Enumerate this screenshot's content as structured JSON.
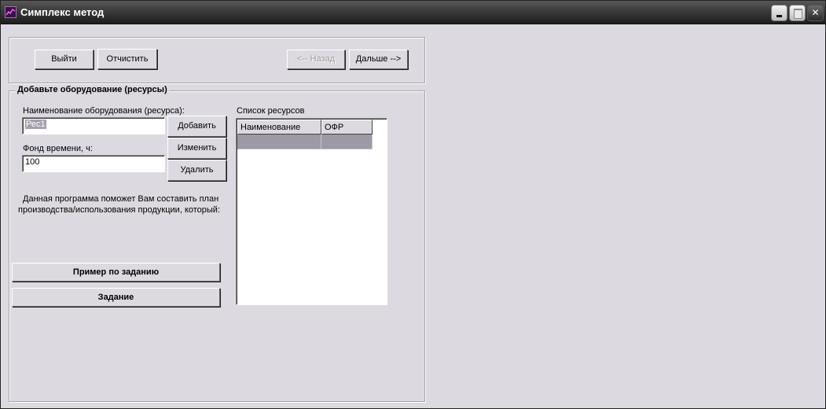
{
  "window": {
    "title": "Симплекс метод"
  },
  "toolbar": {
    "exit_label": "Выйти",
    "clear_label": "Отчистить",
    "back_label": "<-- Назад",
    "next_label": "Дальше -->"
  },
  "resources_group": {
    "legend": "Добавьте оборудование (ресурсы)",
    "name_label": "Наименование оборудования (ресурса):",
    "name_value": "Рес1",
    "time_label": "Фонд времени, ч:",
    "time_value": "100",
    "add_label": "Добавить",
    "edit_label": "Изменить",
    "delete_label": "Удалить",
    "description_line1": "Данная программа поможет Вам составить план",
    "description_line2": "производства/использования продукции, который:",
    "example_label": "Пример по заданию",
    "task_label": "Задание"
  },
  "resource_list": {
    "title": "Список ресурсов",
    "columns": [
      "Наименование",
      "ОФР"
    ],
    "rows": [
      [
        "",
        ""
      ]
    ]
  },
  "colors": {
    "window_bg": "#dcdae0",
    "selection": "#9d9aa5",
    "titlebar_dark": "#1d1d1d"
  }
}
